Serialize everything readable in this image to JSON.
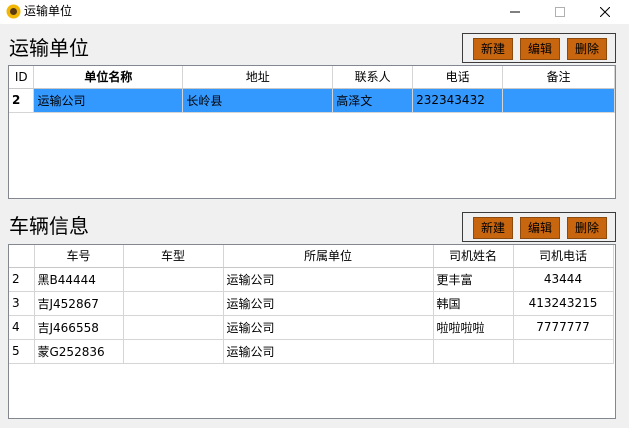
{
  "window": {
    "title": "运输单位"
  },
  "units_section": {
    "title": "运输单位",
    "buttons": {
      "new": "新建",
      "edit": "编辑",
      "delete": "删除"
    },
    "columns": [
      "ID",
      "单位名称",
      "地址",
      "联系人",
      "电话",
      "备注"
    ],
    "rows": [
      {
        "id": "2",
        "name": "运输公司",
        "address": "长岭县",
        "contact": "高泽文",
        "phone": "232343432",
        "note": ""
      }
    ]
  },
  "vehicles_section": {
    "title": "车辆信息",
    "buttons": {
      "new": "新建",
      "edit": "编辑",
      "delete": "删除"
    },
    "columns": [
      "",
      "车号",
      "车型",
      "所属单位",
      "司机姓名",
      "司机电话"
    ],
    "rows": [
      {
        "id": "2",
        "plate": "黑B44444",
        "type": "",
        "unit": "运输公司",
        "driver": "更丰富",
        "phone": "43444"
      },
      {
        "id": "3",
        "plate": "吉J452867",
        "type": "",
        "unit": "运输公司",
        "driver": "韩国",
        "phone": "413243215"
      },
      {
        "id": "4",
        "plate": "吉J466558",
        "type": "",
        "unit": "运输公司",
        "driver": "啦啦啦啦",
        "phone": "7777777"
      },
      {
        "id": "5",
        "plate": "蒙G252836",
        "type": "",
        "unit": "运输公司",
        "driver": "",
        "phone": ""
      }
    ]
  },
  "colors": {
    "button_bg": "#c8650f",
    "selection": "#3399ff"
  },
  "icons": {
    "app": "sunflower-icon",
    "minimize": "minimize-icon",
    "maximize": "maximize-icon",
    "close": "close-icon"
  }
}
